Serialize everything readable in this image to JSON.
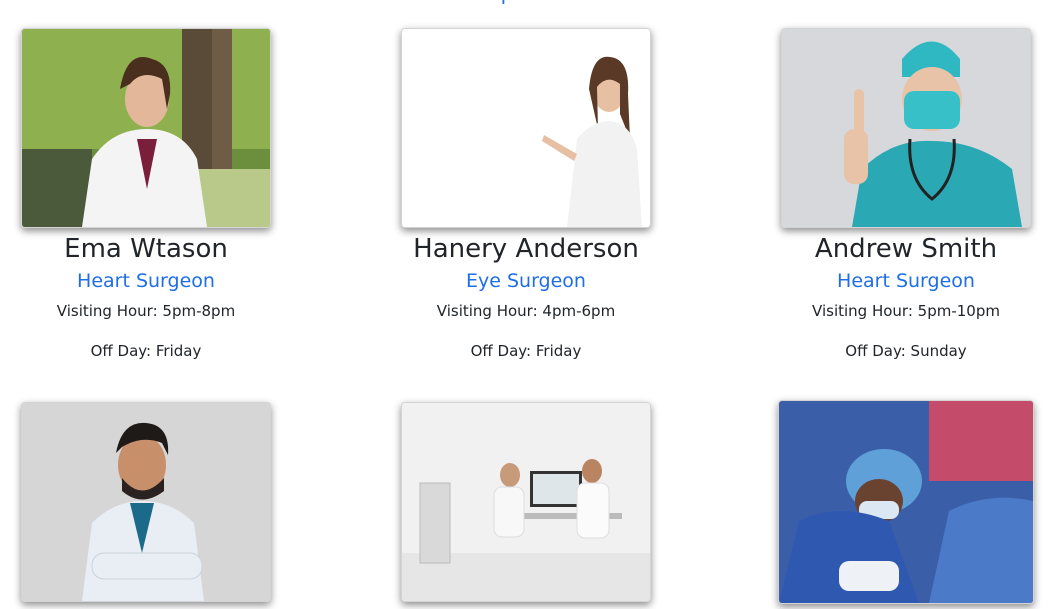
{
  "doctors": [
    {
      "name": "Ema Wtason",
      "role": "Heart Surgeon",
      "hours": "Visiting Hour: 5pm-8pm",
      "off_day": "Off Day: Friday"
    },
    {
      "name": "Hanery Anderson",
      "role": "Eye Surgeon",
      "hours": "Visiting Hour: 4pm-6pm",
      "off_day": "Off Day: Friday"
    },
    {
      "name": "Andrew Smith",
      "role": "Heart Surgeon",
      "hours": "Visiting Hour: 5pm-10pm",
      "off_day": "Off Day: Sunday"
    }
  ],
  "colors": {
    "accent": "#1e6ee8",
    "text": "#212529"
  }
}
